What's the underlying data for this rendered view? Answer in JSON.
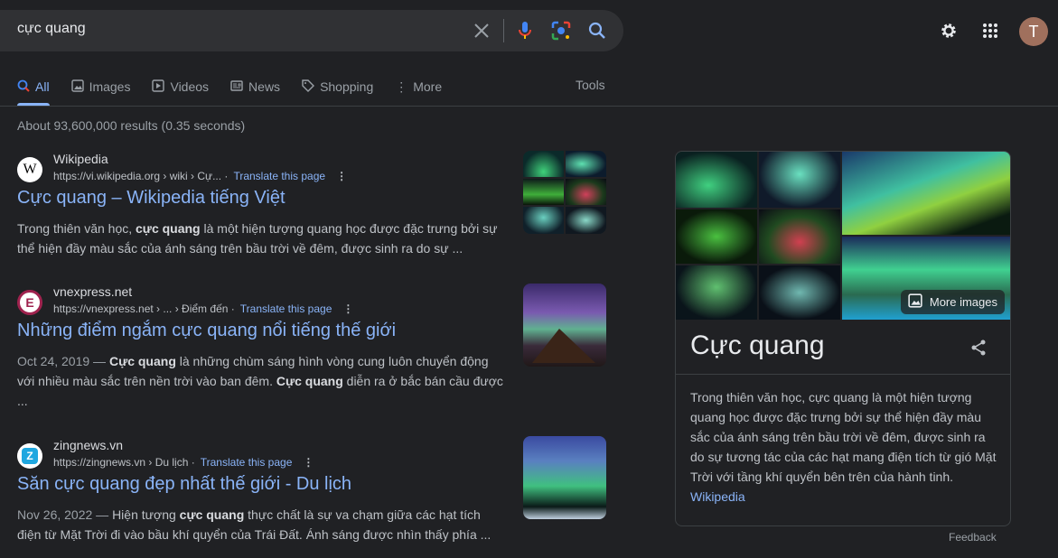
{
  "search": {
    "query": "cực quang"
  },
  "user": {
    "initial": "T"
  },
  "tabs": [
    {
      "label": "All",
      "icon": "search-icon"
    },
    {
      "label": "Images",
      "icon": "image-icon"
    },
    {
      "label": "Videos",
      "icon": "play-icon"
    },
    {
      "label": "News",
      "icon": "news-icon"
    },
    {
      "label": "Shopping",
      "icon": "tag-icon"
    },
    {
      "label": "More",
      "icon": "more-vert-icon"
    }
  ],
  "tools_label": "Tools",
  "result_count": "About 93,600,000 results (0.35 seconds)",
  "results": [
    {
      "site": "Wikipedia",
      "url": "https://vi.wikipedia.org › wiki › Cự...",
      "translate": "Translate this page",
      "title": "Cực quang – Wikipedia tiếng Việt",
      "date": "",
      "snippet": [
        "Trong thiên văn học, ",
        "cực quang",
        " là một hiện tượng quang học được đặc trưng bởi sự thể hiện đầy màu sắc của ánh sáng trên bầu trời về đêm, được sinh ra do sự ...",
        "",
        ""
      ],
      "favicon": "W"
    },
    {
      "site": "vnexpress.net",
      "url": "https://vnexpress.net › ... › Điểm đến",
      "translate": "Translate this page",
      "title": "Những điểm ngắm cực quang nổi tiếng thế giới",
      "date": "Oct 24, 2019 — ",
      "snippet": [
        "",
        "Cực quang",
        " là những chùm sáng hình vòng cung luôn chuyển động với nhiều màu sắc trên nền trời vào ban đêm. ",
        "Cực quang",
        " diễn ra ở bắc bán cầu được ..."
      ],
      "favicon": "E"
    },
    {
      "site": "zingnews.vn",
      "url": "https://zingnews.vn › Du lịch",
      "translate": "Translate this page",
      "title": "Săn cực quang đẹp nhất thế giới - Du lịch",
      "date": "Nov 26, 2022 — ",
      "snippet": [
        "Hiện tượng ",
        "cực quang",
        " thực chất là sự va chạm giữa các hạt tích điện từ Mặt Trời đi vào bầu khí quyển của Trái Đất. Ánh sáng được nhìn thấy phía ...",
        "",
        ""
      ],
      "favicon": "Z"
    }
  ],
  "knowledge_panel": {
    "title": "Cực quang",
    "more_images": "More images",
    "description": "Trong thiên văn học, cực quang là một hiện tượng quang học được đặc trưng bởi sự thể hiện đầy màu sắc của ánh sáng trên bầu trời về đêm, được sinh ra do sự tương tác của các hạt mang điện tích từ gió Mặt Trời với tầng khí quyển bên trên của hành tinh.",
    "source": "Wikipedia"
  },
  "feedback": "Feedback",
  "colors": {
    "background": "#202124",
    "link": "#8ab4f8",
    "search_bg": "#303134"
  }
}
